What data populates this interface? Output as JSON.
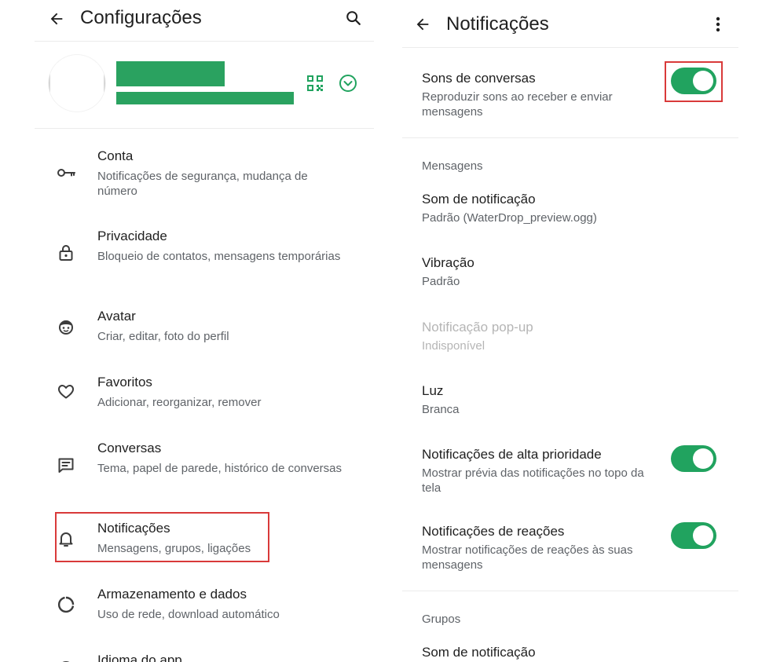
{
  "settings": {
    "title": "Configurações",
    "items": [
      {
        "label": "Conta",
        "desc": "Notificações de segurança, mudança de número",
        "icon": "key-icon"
      },
      {
        "label": "Privacidade",
        "desc": "Bloqueio de contatos, mensagens temporárias",
        "icon": "lock-icon"
      },
      {
        "label": "Avatar",
        "desc": "Criar, editar, foto do perfil",
        "icon": "avatar-face-icon"
      },
      {
        "label": "Favoritos",
        "desc": "Adicionar, reorganizar, remover",
        "icon": "heart-icon"
      },
      {
        "label": "Conversas",
        "desc": "Tema, papel de parede, histórico de conversas",
        "icon": "chat-icon"
      },
      {
        "label": "Notificações",
        "desc": "Mensagens, grupos, ligações",
        "icon": "bell-icon"
      },
      {
        "label": "Armazenamento e dados",
        "desc": "Uso de rede, download automático",
        "icon": "storage-circle-icon"
      },
      {
        "label": "Idioma do app",
        "desc": "",
        "icon": "globe-icon"
      }
    ]
  },
  "notifications": {
    "title": "Notificações",
    "conversation_sounds": {
      "label": "Sons de conversas",
      "desc": "Reproduzir sons ao receber e enviar mensagens",
      "enabled": true
    },
    "messages_section": "Mensagens",
    "message_items": [
      {
        "label": "Som de notificação",
        "desc": "Padrão (WaterDrop_preview.ogg)"
      },
      {
        "label": "Vibração",
        "desc": "Padrão"
      },
      {
        "label": "Notificação pop-up",
        "desc": "Indisponível"
      },
      {
        "label": "Luz",
        "desc": "Branca"
      }
    ],
    "high_priority": {
      "label": "Notificações de alta prioridade",
      "desc": "Mostrar prévia das notificações no topo da tela",
      "enabled": true
    },
    "reactions": {
      "label": "Notificações de reações",
      "desc": "Mostrar notificações de reações às suas mensagens",
      "enabled": true
    },
    "groups_section": "Grupos",
    "group_items": [
      {
        "label": "Som de notificação"
      }
    ]
  },
  "colors": {
    "accent": "#21a35f",
    "highlight": "#d93a3a",
    "secondary_text": "#5f6368",
    "disabled_text": "#b5b5b5"
  }
}
